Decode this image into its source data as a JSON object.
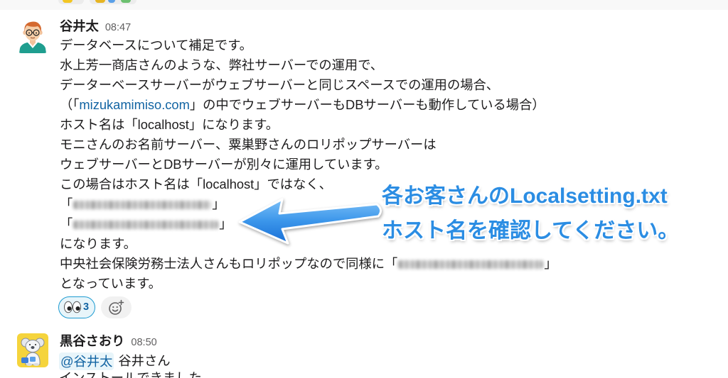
{
  "colors": {
    "text": "#1d1c1d",
    "muted": "#616061",
    "link": "#1264a3",
    "reaction_bg": "#e8f5fa",
    "reaction_border": "#1d9bd1",
    "mention_bg": "#e8f5fa",
    "annotation": "#2b8de3"
  },
  "icons": {
    "reaction": "eyes-emoji-icon",
    "add_reaction": "add-reaction-icon"
  },
  "message1": {
    "author": "谷井太",
    "time": "08:47",
    "body": [
      {
        "text": "データベースについて補足です。"
      },
      {
        "text": "水上芳一商店さんのような、弊社サーバーでの運用で、"
      },
      {
        "text": "データーベースサーバーがウェブサーバーと同じスペースでの運用の場合、"
      },
      {
        "before": "（「",
        "link": "mizukamimiso.com",
        "after": "」の中でウェブサーバーもDBサーバーも動作している場合）"
      },
      {
        "text": "ホスト名は「localhost」になります。"
      },
      {
        "text": "モニさんのお名前サーバー、粟巣野さんのロリポップサーバーは"
      },
      {
        "text": "ウェブサーバーとDBサーバーが別々に運用しています。"
      },
      {
        "text": "この場合はホスト名は「localhost」ではなく、"
      },
      {
        "before": "「",
        "after": "」"
      },
      {
        "before": "「",
        "after": "」"
      },
      {
        "text": "になります。"
      },
      {
        "before": "中央社会保険労務士法人さんもロリポップなので同様に「",
        "after": "」"
      },
      {
        "text": "となっています。"
      }
    ],
    "reactions": [
      {
        "icon": "eyes-emoji-icon",
        "count": "3"
      }
    ]
  },
  "annotation": {
    "line1": "各お客さんのLocalsetting.txt",
    "line2": "ホスト名を確認してください。"
  },
  "message2": {
    "author": "黒谷さおり",
    "time": "08:50",
    "mention": "@谷井太",
    "line1_text": "谷井さん",
    "line2": "インストールできました"
  }
}
